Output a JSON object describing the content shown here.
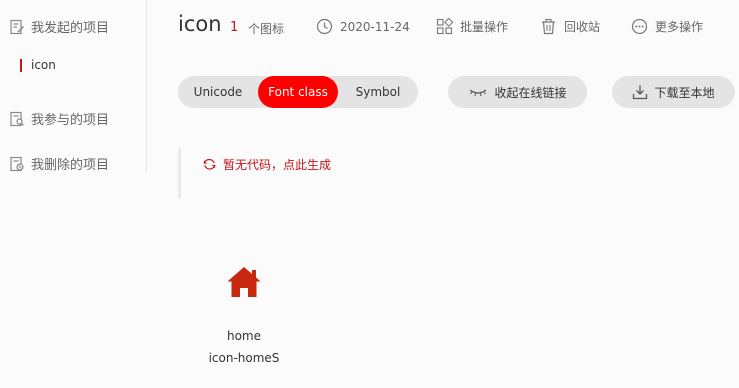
{
  "colors": {
    "accent": "#c0161c",
    "active_pill": "#ff0000",
    "pill_bg": "#e4e4e4",
    "page_bg": "#fbfbfb"
  },
  "sidebar": {
    "my_projects": {
      "label": "我发起的项目",
      "icon": "doc-edit-icon"
    },
    "current_project": {
      "label": "icon"
    },
    "joined_projects": {
      "label": "我参与的项目",
      "icon": "doc-search-icon"
    },
    "deleted_projects": {
      "label": "我删除的项目",
      "icon": "doc-delete-icon"
    }
  },
  "header": {
    "title": "icon",
    "icon_count": "1",
    "icon_count_unit": "个图标",
    "date": {
      "label": "2020-11-24",
      "icon": "clock-icon"
    },
    "batch": {
      "label": "批量操作",
      "icon": "grid-icon"
    },
    "recycle": {
      "label": "回收站",
      "icon": "trash-icon"
    },
    "more": {
      "label": "更多操作",
      "icon": "more-icon"
    }
  },
  "tabs": [
    {
      "label": "Unicode",
      "active": false
    },
    {
      "label": "Font class",
      "active": true
    },
    {
      "label": "Symbol",
      "active": false
    }
  ],
  "actions": {
    "collapse_link": {
      "label": "收起在线链接",
      "icon": "eye-closed-icon"
    },
    "download": {
      "label": "下载至本地",
      "icon": "download-icon"
    }
  },
  "code_area": {
    "generate_label": "暂无代码，点此生成",
    "icon": "refresh-icon"
  },
  "icons": [
    {
      "name": "home",
      "class_name": "icon-homeS",
      "glyph": "home-icon"
    }
  ]
}
